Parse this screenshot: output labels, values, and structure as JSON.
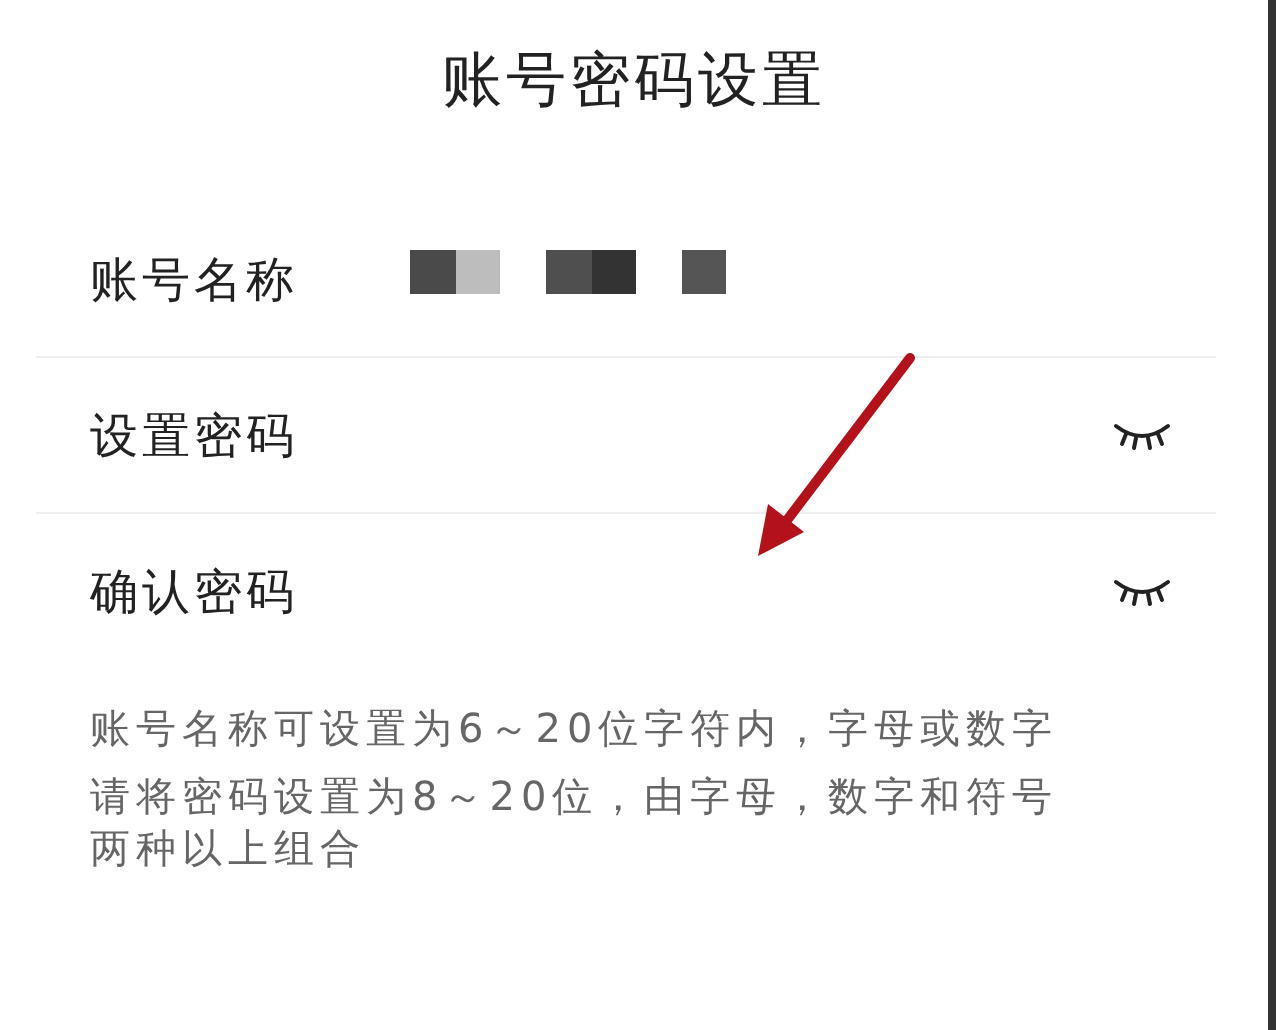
{
  "title": "账号密码设置",
  "rows": [
    {
      "kind": "account",
      "label": "账号名称"
    },
    {
      "kind": "password",
      "label": "设置密码"
    },
    {
      "kind": "password",
      "label": "确认密码"
    }
  ],
  "notes": [
    "账号名称可设置为6～20位字符内，字母或数字",
    "请将密码设置为8～20位，由字母，数字和符号两种以上组合"
  ]
}
